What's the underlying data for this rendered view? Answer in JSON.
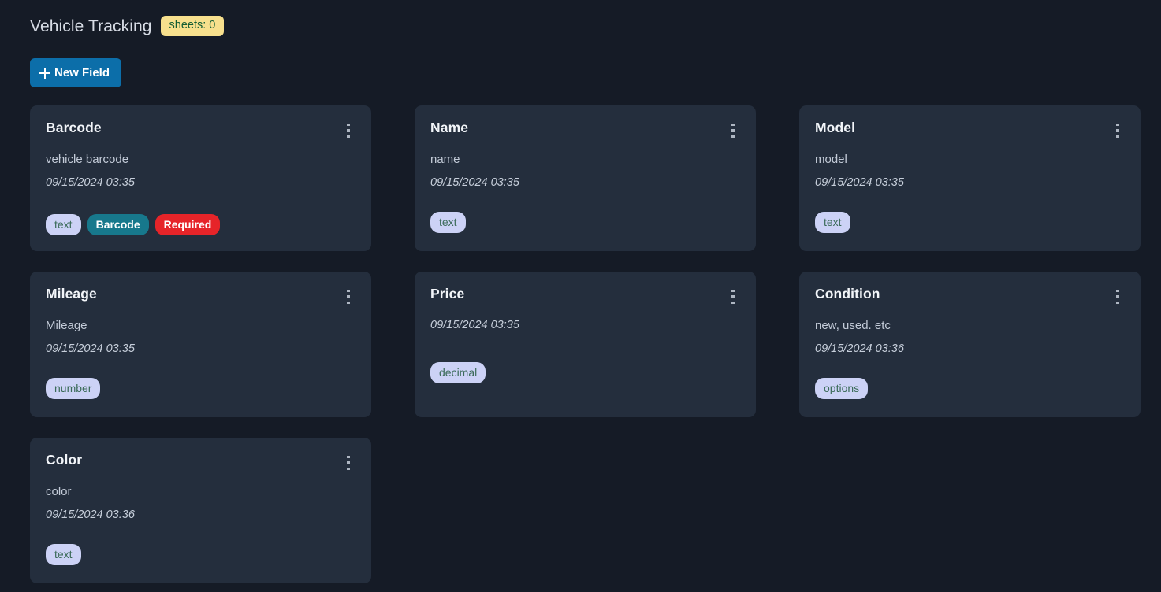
{
  "header": {
    "title": "Vehicle Tracking",
    "sheets_badge": "sheets: 0"
  },
  "toolbar": {
    "new_field_label": "New Field"
  },
  "cards": [
    {
      "title": "Barcode",
      "description": "vehicle barcode",
      "timestamp": "09/15/2024 03:35",
      "badges": [
        {
          "label": "text",
          "kind": "type"
        },
        {
          "label": "Barcode",
          "kind": "barcode"
        },
        {
          "label": "Required",
          "kind": "required"
        }
      ]
    },
    {
      "title": "Name",
      "description": "name",
      "timestamp": "09/15/2024 03:35",
      "badges": [
        {
          "label": "text",
          "kind": "type"
        }
      ]
    },
    {
      "title": "Model",
      "description": "model",
      "timestamp": "09/15/2024 03:35",
      "badges": [
        {
          "label": "text",
          "kind": "type"
        }
      ]
    },
    {
      "title": "Mileage",
      "description": "Mileage",
      "timestamp": "09/15/2024 03:35",
      "badges": [
        {
          "label": "number",
          "kind": "type"
        }
      ]
    },
    {
      "title": "Price",
      "description": "",
      "timestamp": "09/15/2024 03:35",
      "badges": [
        {
          "label": "decimal",
          "kind": "type"
        }
      ]
    },
    {
      "title": "Condition",
      "description": "new, used. etc",
      "timestamp": "09/15/2024 03:36",
      "badges": [
        {
          "label": "options",
          "kind": "type"
        }
      ]
    },
    {
      "title": "Color",
      "description": "color",
      "timestamp": "09/15/2024 03:36",
      "badges": [
        {
          "label": "text",
          "kind": "type"
        }
      ]
    }
  ],
  "colors": {
    "page_background": "#151b26",
    "card_background": "#242e3d",
    "accent_button": "#0c6ea9",
    "sheets_badge_background": "#f7e08d",
    "sheets_badge_text": "#125c33",
    "badge_type_background": "#ccd2f6",
    "badge_type_text": "#3b6b59",
    "badge_barcode_background": "#17788c",
    "badge_required_background": "#e62429"
  },
  "icons": {
    "new_field": "plus-icon",
    "card_menu": "kebab-menu-icon"
  }
}
